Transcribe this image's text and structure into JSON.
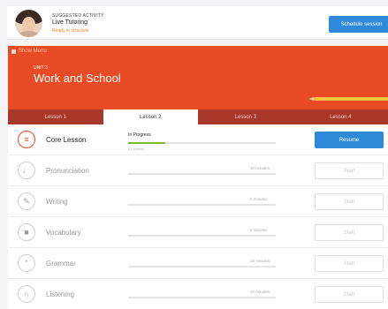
{
  "suggestion": {
    "label": "SUGGESTED ACTIVITY",
    "title": "Live Tutoring",
    "status": "Ready to schedule",
    "button": "Schedule session"
  },
  "header": {
    "show_menu": "Show Menu",
    "unit_label": "UNIT 3",
    "unit_title": "Work and School"
  },
  "tabs": [
    {
      "label": "Lesson 1",
      "active": false
    },
    {
      "label": "Lesson 2",
      "active": true
    },
    {
      "label": "Lesson 3",
      "active": false
    },
    {
      "label": "Lesson 4",
      "active": false
    }
  ],
  "activities": [
    {
      "title": "Core Lesson",
      "icon": "layers-icon",
      "status": "In Progress",
      "sub": "43 correct",
      "progress": 0.25,
      "time": "",
      "button": "Resume",
      "primary": true
    },
    {
      "title": "Pronunciation",
      "icon": "microphone-icon",
      "status": "",
      "sub": "",
      "progress": 0,
      "time": "10 minutes",
      "button": "Start",
      "primary": false
    },
    {
      "title": "Writing",
      "icon": "pencil-icon",
      "status": "",
      "sub": "",
      "progress": 0,
      "time": "5 minutes",
      "button": "Start",
      "primary": false
    },
    {
      "title": "Vocabulary",
      "icon": "book-icon",
      "status": "",
      "sub": "",
      "progress": 0,
      "time": "5 minutes",
      "button": "Start",
      "primary": false
    },
    {
      "title": "Grammar",
      "icon": "quote-icon",
      "status": "",
      "sub": "",
      "progress": 0,
      "time": "10 minutes",
      "button": "Start",
      "primary": false
    },
    {
      "title": "Listening",
      "icon": "headphones-icon",
      "status": "",
      "sub": "",
      "progress": 0,
      "time": "10 minutes",
      "button": "Start",
      "primary": false
    }
  ],
  "colors": {
    "accent": "#e94c24",
    "tab_bar": "#a9372a",
    "primary_button": "#2e8ad8",
    "progress": "#7bbd2a"
  }
}
